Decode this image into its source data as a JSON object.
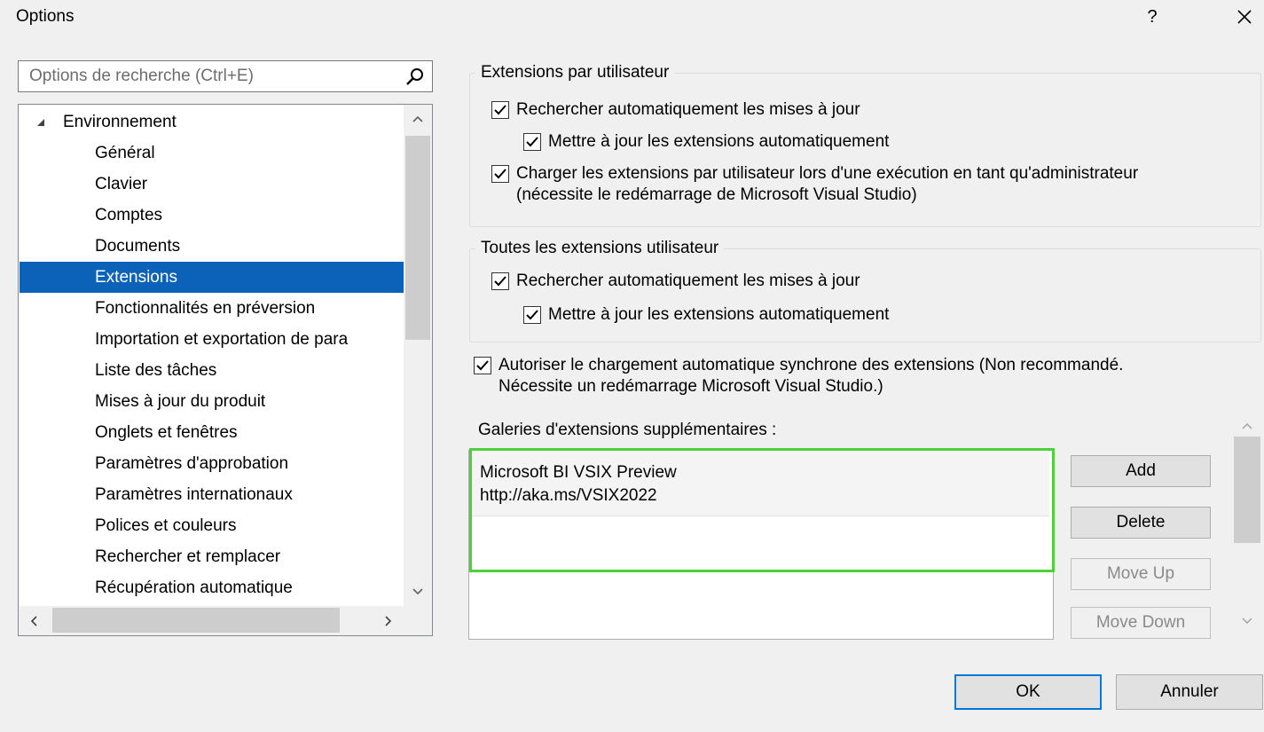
{
  "window": {
    "title": "Options",
    "help": "?",
    "close": "×"
  },
  "search": {
    "placeholder": "Options de recherche (Ctrl+E)"
  },
  "tree": {
    "root": "Environnement",
    "items": [
      "Général",
      "Clavier",
      "Comptes",
      "Documents",
      "Extensions",
      "Fonctionnalités en préversion",
      "Importation et exportation de para",
      "Liste des tâches",
      "Mises à jour du produit",
      "Onglets et fenêtres",
      "Paramètres d'approbation",
      "Paramètres internationaux",
      "Polices et couleurs",
      "Rechercher et remplacer",
      "Récupération automatique"
    ],
    "selected": "Extensions"
  },
  "per_user": {
    "legend": "Extensions par utilisateur",
    "check_updates": "Rechercher automatiquement les mises à jour",
    "auto_update": "Mettre à jour les extensions automatiquement",
    "load_admin": "Charger les extensions par utilisateur lors d'une exécution en tant qu'administrateur (nécessite le redémarrage de Microsoft Visual Studio)"
  },
  "all_users": {
    "legend": "Toutes les extensions utilisateur",
    "check_updates": "Rechercher automatiquement les mises à jour",
    "auto_update": "Mettre à jour les extensions automatiquement"
  },
  "sync_load": "Autoriser le chargement automatique synchrone des extensions (Non recommandé. Nécessite un redémarrage Microsoft Visual Studio.)",
  "gallery": {
    "label": "Galeries d'extensions supplémentaires :",
    "entries": [
      {
        "name": "Microsoft BI VSIX Preview",
        "url": "http://aka.ms/VSIX2022"
      }
    ]
  },
  "buttons": {
    "add": "Add",
    "delete": "Delete",
    "move_up": "Move Up",
    "move_down": "Move Down",
    "ok": "OK",
    "cancel": "Annuler"
  },
  "colors": {
    "selection": "#0c62b9",
    "highlight": "#4cd13a",
    "default_button": "#0078d7"
  }
}
